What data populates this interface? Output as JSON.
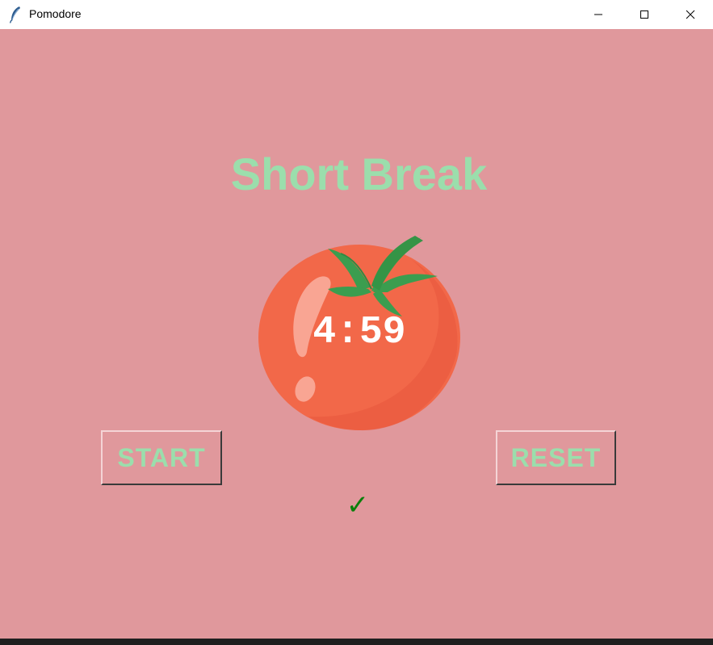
{
  "window": {
    "title": "Pomodore",
    "icon": "feather-icon",
    "controls": [
      "minimize-icon",
      "maximize-icon",
      "close-icon"
    ]
  },
  "app": {
    "heading": "Short Break",
    "timer": "4:59",
    "start_label": "START",
    "reset_label": "RESET",
    "checkmarks": "✓"
  },
  "colors": {
    "background": "#e0989c",
    "heading_green": "#9bdeac",
    "check_green": "#0a7f0a",
    "tomato": "#f26849",
    "leaf": "#3b9d4f"
  }
}
